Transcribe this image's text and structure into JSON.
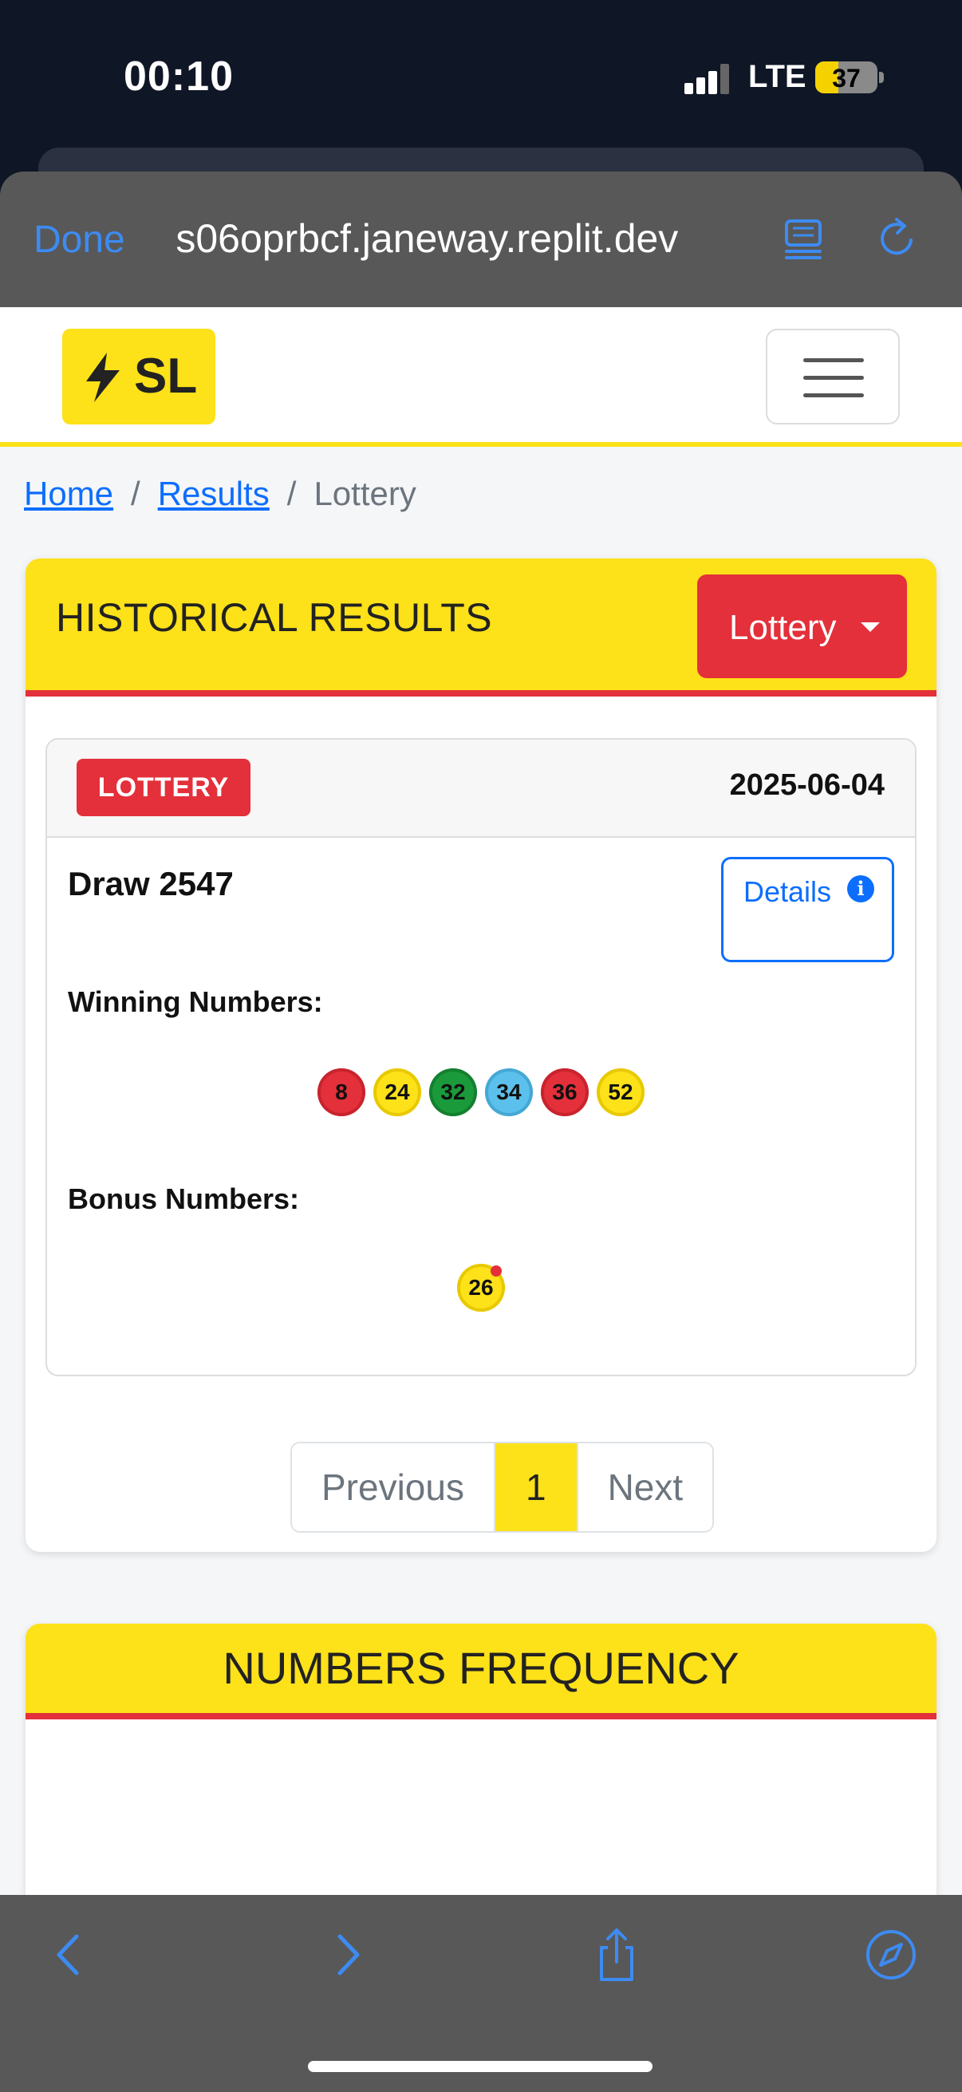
{
  "status_bar": {
    "time": "00:10",
    "network": "LTE",
    "battery_level": "37",
    "battery_fraction": 0.37
  },
  "browser": {
    "done_label": "Done",
    "url": " s06oprbcf.janeway.replit.dev",
    "reader_icon": "reader-mode-icon",
    "reload_icon": "reload-icon"
  },
  "navbar": {
    "brand_icon": "lightning-bolt-icon",
    "brand_text": "SL",
    "menu_icon": "hamburger-menu-icon"
  },
  "breadcrumb": {
    "items": [
      "Home",
      "Results",
      "Lottery"
    ],
    "separator": "/"
  },
  "historical": {
    "title": "HISTORICAL RESULTS",
    "dropdown_label": "Lottery",
    "result": {
      "badge": "LOTTERY",
      "date": "2025-06-04",
      "draw": "Draw 2547",
      "details_label": "Details",
      "details_icon": "info-icon",
      "winning_label": "Winning Numbers:",
      "winning_numbers": [
        {
          "value": "8",
          "color": "#e3303a"
        },
        {
          "value": "24",
          "color": "#fde119"
        },
        {
          "value": "32",
          "color": "#1b9a3b"
        },
        {
          "value": "34",
          "color": "#5bc0eb"
        },
        {
          "value": "36",
          "color": "#e3303a"
        },
        {
          "value": "52",
          "color": "#fde119"
        }
      ],
      "bonus_label": "Bonus Numbers:",
      "bonus_numbers": [
        {
          "value": "26",
          "color": "#fde119"
        }
      ]
    },
    "pagination": {
      "previous": "Previous",
      "current": "1",
      "next": "Next"
    }
  },
  "frequency": {
    "title": "NUMBERS FREQUENCY"
  },
  "toolbar": {
    "icons": [
      "back-icon",
      "forward-icon",
      "share-icon",
      "compass-icon"
    ]
  },
  "colors": {
    "brand_yellow": "#fde119",
    "brand_red": "#e3303a",
    "link_blue": "#0d6efd",
    "ios_blue": "#3d8bf2"
  }
}
